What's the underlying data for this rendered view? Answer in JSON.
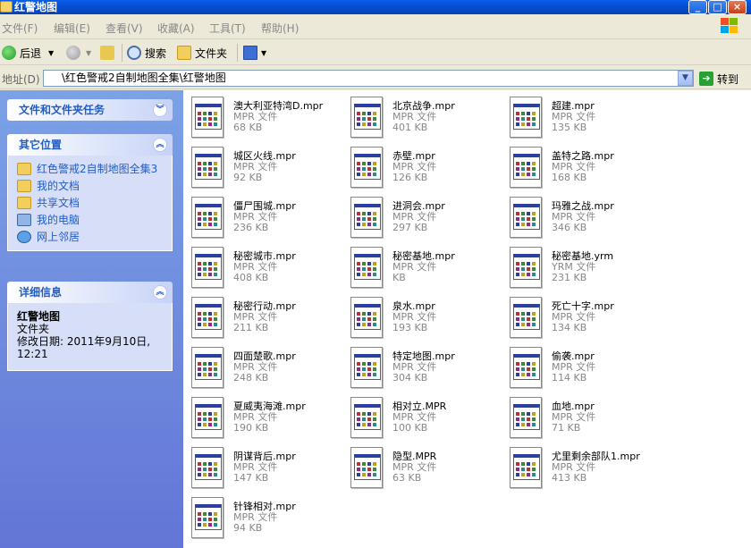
{
  "window": {
    "title": "红警地图"
  },
  "menu": [
    "文件(F)",
    "编辑(E)",
    "查看(V)",
    "收藏(A)",
    "工具(T)",
    "帮助(H)"
  ],
  "toolbar": {
    "back": "后退",
    "search": "搜索",
    "folders": "文件夹"
  },
  "address": {
    "label": "地址(D)",
    "value": "\\红色警戒2自制地图全集\\红警地图",
    "go": "转到"
  },
  "tasks": {
    "file_tasks_title": "文件和文件夹任务",
    "other_places_title": "其它位置",
    "other_places": [
      {
        "label": "红色警戒2自制地图全集3",
        "icon": "folder-icon"
      },
      {
        "label": "我的文档",
        "icon": "my-documents-icon"
      },
      {
        "label": "共享文档",
        "icon": "shared-documents-icon"
      },
      {
        "label": "我的电脑",
        "icon": "my-computer-icon"
      },
      {
        "label": "网上邻居",
        "icon": "network-places-icon"
      }
    ],
    "details_title": "详细信息",
    "details": {
      "name": "红警地图",
      "type": "文件夹",
      "modified": "修改日期: 2011年9月10日, 12:21"
    }
  },
  "files": [
    {
      "name": "澳大利亚特湾D.mpr",
      "type": "MPR 文件",
      "size": "68 KB"
    },
    {
      "name": "北京战争.mpr",
      "type": "MPR 文件",
      "size": "401 KB"
    },
    {
      "name": "超建.mpr",
      "type": "MPR 文件",
      "size": "135 KB"
    },
    {
      "name": "城区火线.mpr",
      "type": "MPR 文件",
      "size": "92 KB"
    },
    {
      "name": "赤壁.mpr",
      "type": "MPR 文件",
      "size": "126 KB"
    },
    {
      "name": "盖特之路.mpr",
      "type": "MPR 文件",
      "size": "168 KB"
    },
    {
      "name": "僵尸围城.mpr",
      "type": "MPR 文件",
      "size": "236 KB"
    },
    {
      "name": "进洞会.mpr",
      "type": "MPR 文件",
      "size": "297 KB"
    },
    {
      "name": "玛雅之战.mpr",
      "type": "MPR 文件",
      "size": "346 KB"
    },
    {
      "name": "秘密城市.mpr",
      "type": "MPR 文件",
      "size": "408 KB"
    },
    {
      "name": "秘密基地.mpr",
      "type": "MPR 文件",
      "size": "KB"
    },
    {
      "name": "秘密基地.yrm",
      "type": "YRM 文件",
      "size": "231 KB"
    },
    {
      "name": "秘密行动.mpr",
      "type": "MPR 文件",
      "size": "211 KB"
    },
    {
      "name": "泉水.mpr",
      "type": "MPR 文件",
      "size": "193 KB"
    },
    {
      "name": "死亡十字.mpr",
      "type": "MPR 文件",
      "size": "134 KB"
    },
    {
      "name": "四面楚歌.mpr",
      "type": "MPR 文件",
      "size": "248 KB"
    },
    {
      "name": "特定地图.mpr",
      "type": "MPR 文件",
      "size": "304 KB"
    },
    {
      "name": "偷袭.mpr",
      "type": "MPR 文件",
      "size": "114 KB"
    },
    {
      "name": "夏威夷海滩.mpr",
      "type": "MPR 文件",
      "size": "190 KB"
    },
    {
      "name": "相对立.MPR",
      "type": "MPR 文件",
      "size": "100 KB"
    },
    {
      "name": "血地.mpr",
      "type": "MPR 文件",
      "size": "71 KB"
    },
    {
      "name": "阴谋背后.mpr",
      "type": "MPR 文件",
      "size": "147 KB"
    },
    {
      "name": "隐型.MPR",
      "type": "MPR 文件",
      "size": "63 KB"
    },
    {
      "name": "尤里剩余部队1.mpr",
      "type": "MPR 文件",
      "size": "413 KB"
    },
    {
      "name": "针锋相对.mpr",
      "type": "MPR 文件",
      "size": "94 KB"
    }
  ]
}
